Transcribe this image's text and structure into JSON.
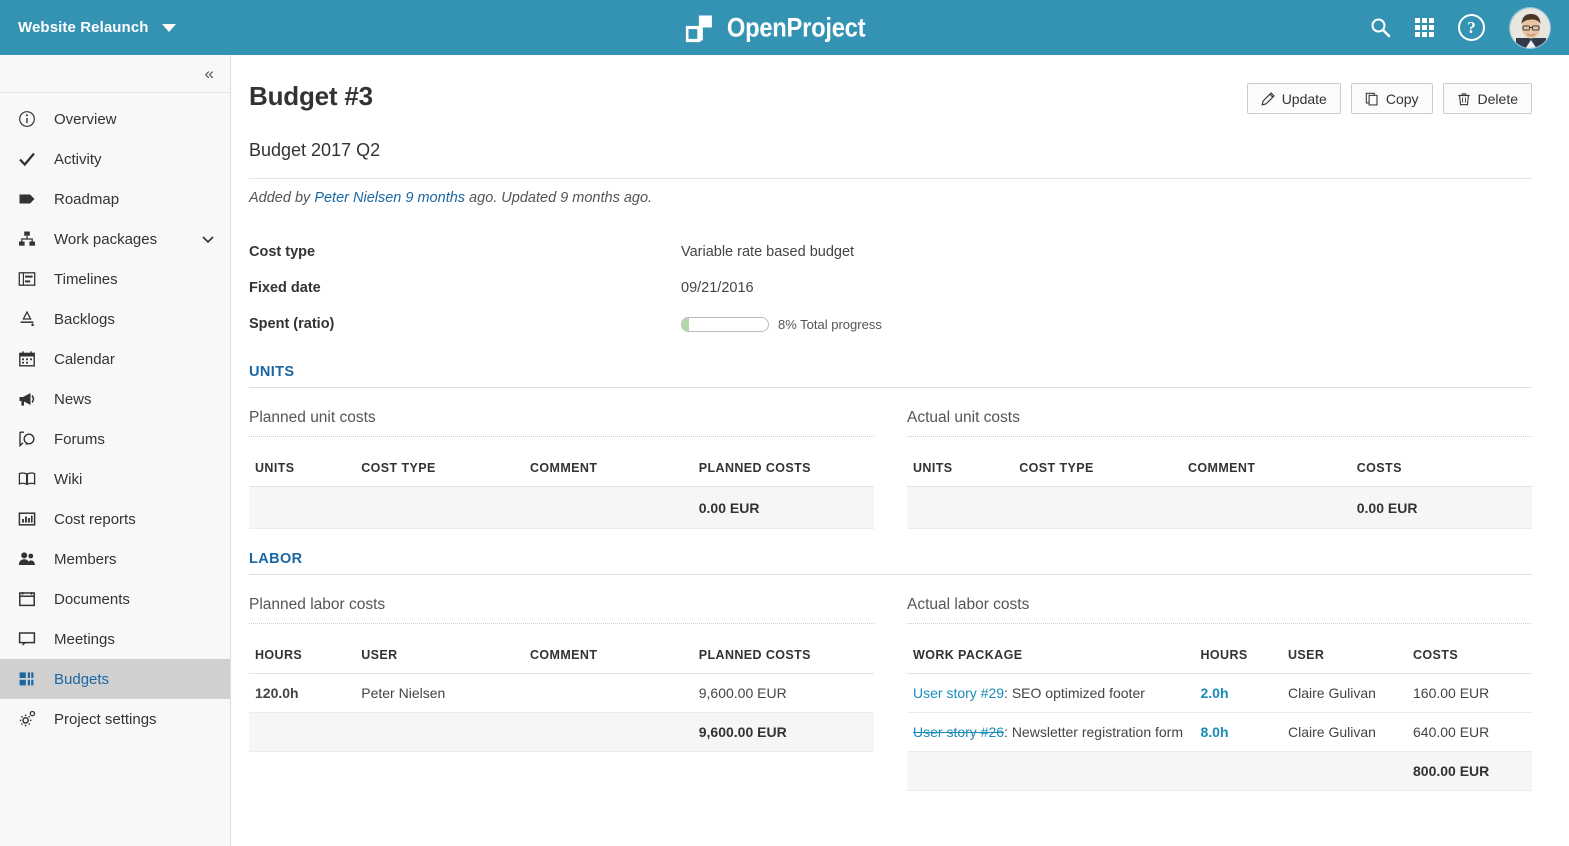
{
  "header": {
    "project_name": "Website Relaunch",
    "logo_text": "OpenProject",
    "icons": {
      "search": "search-icon",
      "modules": "grid-modules-icon",
      "help": "?",
      "avatar": "user-avatar"
    }
  },
  "sidebar": {
    "collapse_label": "«",
    "items": [
      {
        "label": "Overview",
        "icon": "info-circle-icon",
        "active": false,
        "expandable": false
      },
      {
        "label": "Activity",
        "icon": "check-icon",
        "active": false,
        "expandable": false
      },
      {
        "label": "Roadmap",
        "icon": "tag-icon",
        "active": false,
        "expandable": false
      },
      {
        "label": "Work packages",
        "icon": "hierarchy-icon",
        "active": false,
        "expandable": true
      },
      {
        "label": "Timelines",
        "icon": "gantt-icon",
        "active": false,
        "expandable": false
      },
      {
        "label": "Backlogs",
        "icon": "backlog-icon",
        "active": false,
        "expandable": false
      },
      {
        "label": "Calendar",
        "icon": "calendar-icon",
        "active": false,
        "expandable": false
      },
      {
        "label": "News",
        "icon": "megaphone-icon",
        "active": false,
        "expandable": false
      },
      {
        "label": "Forums",
        "icon": "forum-icon",
        "active": false,
        "expandable": false
      },
      {
        "label": "Wiki",
        "icon": "book-icon",
        "active": false,
        "expandable": false
      },
      {
        "label": "Cost reports",
        "icon": "bar-chart-icon",
        "active": false,
        "expandable": false
      },
      {
        "label": "Members",
        "icon": "people-icon",
        "active": false,
        "expandable": false
      },
      {
        "label": "Documents",
        "icon": "document-icon",
        "active": false,
        "expandable": false
      },
      {
        "label": "Meetings",
        "icon": "speech-bubble-icon",
        "active": false,
        "expandable": false
      },
      {
        "label": "Budgets",
        "icon": "budget-icon",
        "active": true,
        "expandable": false
      },
      {
        "label": "Project settings",
        "icon": "gear-icon",
        "active": false,
        "expandable": false
      }
    ]
  },
  "page": {
    "title": "Budget #3",
    "subject": "Budget 2017 Q2",
    "meta": {
      "prefix": "Added by ",
      "author": "Peter Nielsen",
      "author_time": " 9 months",
      "middle": " ago. Updated ",
      "updated_time": "9 months",
      "suffix": " ago."
    }
  },
  "toolbar": {
    "update_label": "Update",
    "copy_label": "Copy",
    "delete_label": "Delete"
  },
  "attributes": [
    {
      "label": "Cost type",
      "value": "Variable rate based budget"
    },
    {
      "label": "Fixed date",
      "value": "09/21/2016"
    }
  ],
  "spent": {
    "label": "Spent (ratio)",
    "percent": 8,
    "percent_text": "8% Total progress",
    "fill_color": "#b3d8a8"
  },
  "sections": [
    {
      "title": "UNITS",
      "left": {
        "heading": "Planned unit costs",
        "columns": [
          "UNITS",
          "COST TYPE",
          "COMMENT",
          "PLANNED COSTS"
        ],
        "rows": [],
        "total": "0.00 EUR"
      },
      "right": {
        "heading": "Actual unit costs",
        "columns": [
          "UNITS",
          "COST TYPE",
          "COMMENT",
          "COSTS"
        ],
        "rows": [],
        "total": "0.00 EUR"
      }
    },
    {
      "title": "LABOR",
      "left": {
        "heading": "Planned labor costs",
        "columns": [
          "HOURS",
          "USER",
          "COMMENT",
          "PLANNED COSTS"
        ],
        "rows": [
          {
            "hours": "120.0h",
            "user": "Peter Nielsen",
            "comment": "",
            "costs": "9,600.00 EUR"
          }
        ],
        "total": "9,600.00 EUR"
      },
      "right": {
        "heading": "Actual labor costs",
        "columns": [
          "WORK PACKAGE",
          "HOURS",
          "USER",
          "COSTS"
        ],
        "rows": [
          {
            "wp_link": "User story #29",
            "wp_closed": false,
            "wp_rest": ": SEO optimized footer",
            "hours": "2.0h",
            "user": "Claire Gulivan",
            "costs": "160.00 EUR"
          },
          {
            "wp_link": "User story #26",
            "wp_closed": true,
            "wp_rest": ": Newsletter registration form",
            "hours": "8.0h",
            "user": "Claire Gulivan",
            "costs": "640.00 EUR"
          }
        ],
        "total": "800.00 EUR"
      }
    }
  ],
  "colors": {
    "header_bg": "#3493b3",
    "accent_blue": "#1a67a3",
    "link_blue": "#1a8bb9",
    "sidebar_bg": "#f8f8f8",
    "active_item_bg": "#d0d0d0",
    "total_row_bg": "#f6f6f6"
  }
}
